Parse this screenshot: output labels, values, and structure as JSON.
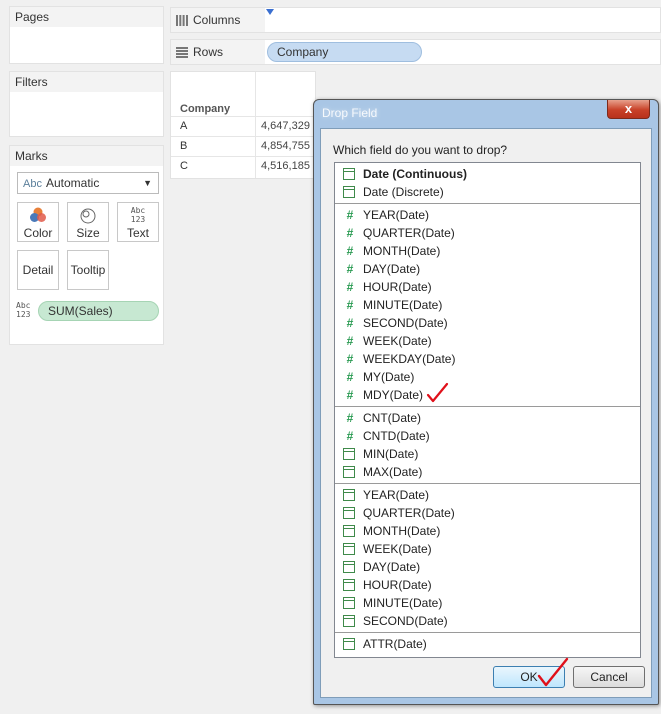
{
  "panels": {
    "pages_label": "Pages",
    "filters_label": "Filters",
    "marks_label": "Marks"
  },
  "marks": {
    "type_icon": "Abc",
    "type_value": "Automatic",
    "buttons": {
      "color": "Color",
      "size": "Size",
      "text": "Text",
      "detail": "Detail",
      "tooltip": "Tooltip"
    },
    "text_icon_line1": "Abc",
    "text_icon_line2": "123",
    "pill_icon_line1": "Abc",
    "pill_icon_line2": "123",
    "pill_label": "SUM(Sales)"
  },
  "shelves": {
    "columns_label": "Columns",
    "rows_label": "Rows",
    "rows_pill": "Company"
  },
  "view": {
    "header": "Company",
    "rows": [
      {
        "key": "A",
        "value": "4,647,329"
      },
      {
        "key": "B",
        "value": "4,854,755"
      },
      {
        "key": "C",
        "value": "4,516,185"
      }
    ]
  },
  "dialog": {
    "title": "Drop Field",
    "close_glyph": "x",
    "question": "Which field do you want to drop?",
    "items": [
      {
        "icon": "calendar-icon",
        "label": "Date (Continuous)"
      },
      {
        "icon": "calendar-icon",
        "label": "Date (Discrete)"
      },
      {
        "icon": "hash-icon",
        "label": "YEAR(Date)"
      },
      {
        "icon": "hash-icon",
        "label": "QUARTER(Date)"
      },
      {
        "icon": "hash-icon",
        "label": "MONTH(Date)"
      },
      {
        "icon": "hash-icon",
        "label": "DAY(Date)"
      },
      {
        "icon": "hash-icon",
        "label": "HOUR(Date)"
      },
      {
        "icon": "hash-icon",
        "label": "MINUTE(Date)"
      },
      {
        "icon": "hash-icon",
        "label": "SECOND(Date)"
      },
      {
        "icon": "hash-icon",
        "label": "WEEK(Date)"
      },
      {
        "icon": "hash-icon",
        "label": "WEEKDAY(Date)"
      },
      {
        "icon": "hash-icon",
        "label": "MY(Date)"
      },
      {
        "icon": "hash-icon",
        "label": "MDY(Date)"
      },
      {
        "icon": "hash-icon",
        "label": "CNT(Date)"
      },
      {
        "icon": "hash-icon",
        "label": "CNTD(Date)"
      },
      {
        "icon": "calendar-icon",
        "label": "MIN(Date)"
      },
      {
        "icon": "calendar-icon",
        "label": "MAX(Date)"
      },
      {
        "icon": "calendar-icon",
        "label": "YEAR(Date)"
      },
      {
        "icon": "calendar-icon",
        "label": "QUARTER(Date)"
      },
      {
        "icon": "calendar-icon",
        "label": "MONTH(Date)"
      },
      {
        "icon": "calendar-icon",
        "label": "WEEK(Date)"
      },
      {
        "icon": "calendar-icon",
        "label": "DAY(Date)"
      },
      {
        "icon": "calendar-icon",
        "label": "HOUR(Date)"
      },
      {
        "icon": "calendar-icon",
        "label": "MINUTE(Date)"
      },
      {
        "icon": "calendar-icon",
        "label": "SECOND(Date)"
      },
      {
        "icon": "calendar-icon",
        "label": "ATTR(Date)"
      }
    ],
    "ok_label": "OK",
    "cancel_label": "Cancel"
  },
  "colors": {
    "dialog_frame": "#a9c6e5",
    "blue_pill": "#c6dbf2",
    "green_pill": "#c7e8d2",
    "checkmark": "#e0101a"
  }
}
